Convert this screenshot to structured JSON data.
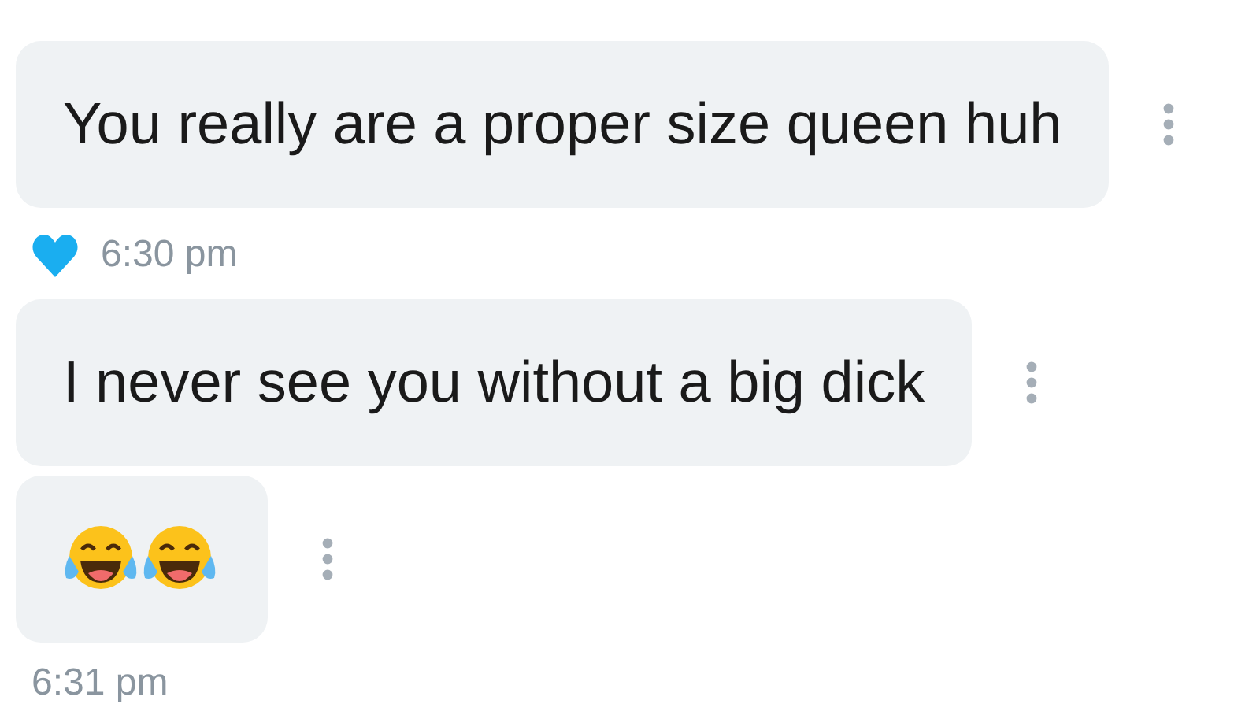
{
  "messages": [
    {
      "kind": "text",
      "text": "You really are a proper size queen huh"
    },
    {
      "kind": "time",
      "time": "6:30 pm",
      "liked": true
    },
    {
      "kind": "text",
      "text": "I never see you without a big dick"
    },
    {
      "kind": "emoji"
    },
    {
      "kind": "time",
      "time": "6:31 pm",
      "liked": false
    }
  ]
}
